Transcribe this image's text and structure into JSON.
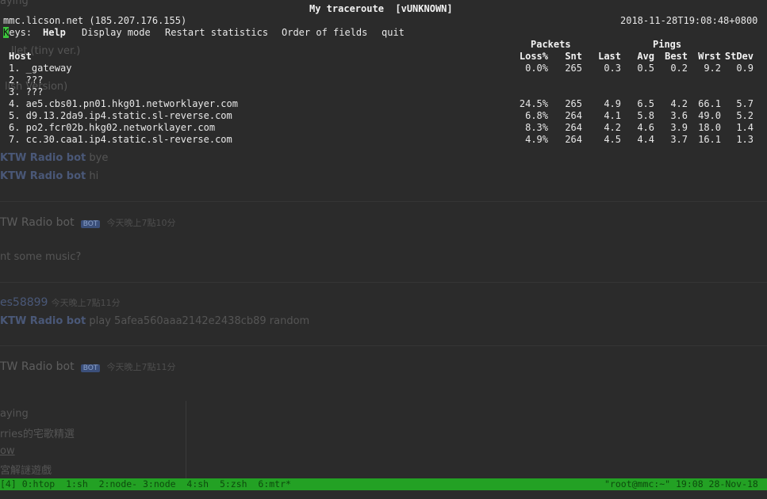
{
  "title": "My traceroute  [vUNKNOWN]",
  "host_line": "mmc.licson.net (185.207.176.155)",
  "timestamp": "2018-11-28T19:08:48+0800",
  "keys": {
    "cursor": "K",
    "label_rest": "eys:",
    "help": "Help",
    "display_mode": "Display mode",
    "restart_statistics": "Restart statistics",
    "order_of_fields": "Order of fields",
    "quit": "quit"
  },
  "headers": {
    "packets": "Packets",
    "pings": "Pings",
    "host": "Host",
    "loss": "Loss%",
    "snt": "Snt",
    "last": "Last",
    "avg": "Avg",
    "best": "Best",
    "wrst": "Wrst",
    "stdev": "StDev"
  },
  "hops": [
    {
      "host": "1. _gateway",
      "loss": "0.0%",
      "snt": "265",
      "last": "0.3",
      "avg": "0.5",
      "best": "0.2",
      "wrst": "9.2",
      "stdev": "0.9"
    },
    {
      "host": "2. ???",
      "loss": "",
      "snt": "",
      "last": "",
      "avg": "",
      "best": "",
      "wrst": "",
      "stdev": ""
    },
    {
      "host": "3. ???",
      "loss": "",
      "snt": "",
      "last": "",
      "avg": "",
      "best": "",
      "wrst": "",
      "stdev": ""
    },
    {
      "host": "4. ae5.cbs01.pn01.hkg01.networklayer.com",
      "loss": "24.5%",
      "snt": "265",
      "last": "4.9",
      "avg": "6.5",
      "best": "4.2",
      "wrst": "66.1",
      "stdev": "5.7"
    },
    {
      "host": "5. d9.13.2da9.ip4.static.sl-reverse.com",
      "loss": "6.8%",
      "snt": "264",
      "last": "4.1",
      "avg": "5.8",
      "best": "3.6",
      "wrst": "49.0",
      "stdev": "5.2"
    },
    {
      "host": "6. po2.fcr02b.hkg02.networklayer.com",
      "loss": "8.3%",
      "snt": "264",
      "last": "4.2",
      "avg": "4.6",
      "best": "3.9",
      "wrst": "18.0",
      "stdev": "1.4"
    },
    {
      "host": "7. cc.30.caa1.ip4.static.sl-reverse.com",
      "loss": "4.9%",
      "snt": "264",
      "last": "4.5",
      "avg": "4.4",
      "best": "3.7",
      "wrst": "16.1",
      "stdev": "1.3"
    }
  ],
  "tmux": {
    "windows": "[4] 0:htop  1:sh  2:node- 3:node  4:sh  5:zsh  6:mtr*",
    "right": "\"root@mmc:~\" 19:08 28-Nov-18"
  },
  "background": {
    "playing_top": "aying",
    "tiny_ver": "llet (tiny ver.)",
    "english_ver": "lish Version)",
    "bot_name": "KTW Radio bot",
    "bye": "bye",
    "hi": "hi",
    "header_bot": "TW Radio bot",
    "badge": "BOT",
    "time_1": "今天晚上7點10分",
    "music_q": "nt some music?",
    "user": "es58899",
    "time_2": "今天晚上7點11分",
    "play_cmd": "play 5afea560aaa2142e2438cb89 random",
    "time_3": "今天晚上7點11分",
    "playing_card": "aying",
    "card_line_1": "rries的宅歌精選",
    "card_line_2": "ow",
    "card_line_3": "宮解謎遊戲"
  },
  "colors": {
    "status_bar": "#23a124",
    "cursor": "#3cc43c",
    "background": "#2b2b2b"
  }
}
